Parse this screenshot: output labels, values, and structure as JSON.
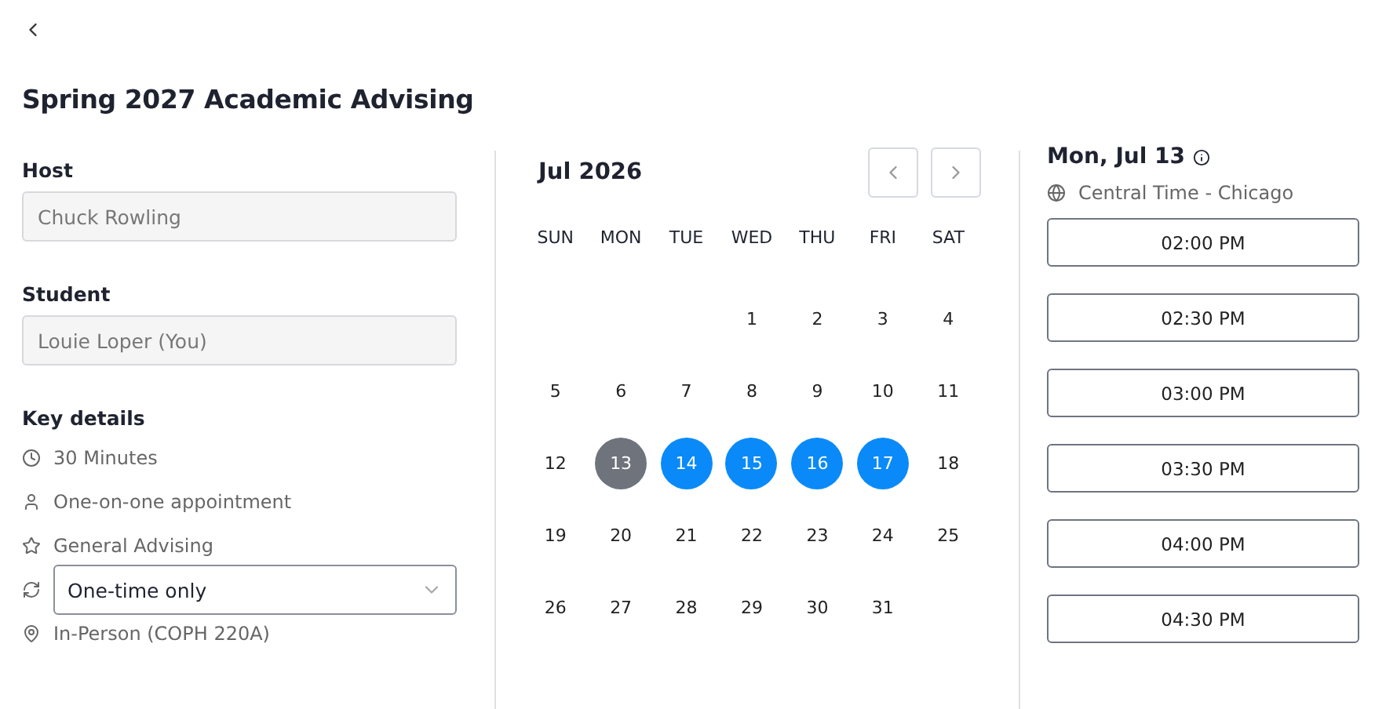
{
  "title": "Spring 2027 Academic Advising",
  "host": {
    "label": "Host",
    "value": "Chuck Rowling"
  },
  "student": {
    "label": "Student",
    "value": "Louie Loper (You)"
  },
  "key_details": {
    "label": "Key details",
    "items": [
      {
        "kind": "clock",
        "text": "30 Minutes"
      },
      {
        "kind": "person",
        "text": "One-on-one appointment"
      },
      {
        "kind": "star",
        "text": "General Advising"
      },
      {
        "kind": "repeat",
        "select": "One-time only"
      },
      {
        "kind": "location",
        "text": "In-Person (COPH 220A)"
      }
    ]
  },
  "calendar": {
    "month": "Jul 2026",
    "weekdays": [
      "SUN",
      "MON",
      "TUE",
      "WED",
      "THU",
      "FRI",
      "SAT"
    ],
    "weeks": [
      [
        {
          "day": "1",
          "available": false,
          "selected": false
        },
        {
          "day": "2",
          "available": false,
          "selected": false
        },
        {
          "day": "3",
          "available": false,
          "selected": false
        },
        {
          "day": "4",
          "available": false,
          "selected": false
        }
      ],
      [
        {
          "day": "5",
          "available": false,
          "selected": false
        },
        {
          "day": "6",
          "available": false,
          "selected": false
        },
        {
          "day": "7",
          "available": false,
          "selected": false
        },
        {
          "day": "8",
          "available": false,
          "selected": false
        },
        {
          "day": "9",
          "available": false,
          "selected": false
        },
        {
          "day": "10",
          "available": false,
          "selected": false
        },
        {
          "day": "11",
          "available": false,
          "selected": false
        }
      ],
      [
        {
          "day": "12",
          "available": false,
          "selected": false
        },
        {
          "day": "13",
          "available": true,
          "selected": true
        },
        {
          "day": "14",
          "available": true,
          "selected": false
        },
        {
          "day": "15",
          "available": true,
          "selected": false
        },
        {
          "day": "16",
          "available": true,
          "selected": false
        },
        {
          "day": "17",
          "available": true,
          "selected": false
        },
        {
          "day": "18",
          "available": false,
          "selected": false
        }
      ],
      [
        {
          "day": "19",
          "available": false,
          "selected": false
        },
        {
          "day": "20",
          "available": false,
          "selected": false
        },
        {
          "day": "21",
          "available": false,
          "selected": false
        },
        {
          "day": "22",
          "available": false,
          "selected": false
        },
        {
          "day": "23",
          "available": false,
          "selected": false
        },
        {
          "day": "24",
          "available": false,
          "selected": false
        },
        {
          "day": "25",
          "available": false,
          "selected": false
        }
      ],
      [
        {
          "day": "26",
          "available": false,
          "selected": false
        },
        {
          "day": "27",
          "available": false,
          "selected": false
        },
        {
          "day": "28",
          "available": false,
          "selected": false
        },
        {
          "day": "29",
          "available": false,
          "selected": false
        },
        {
          "day": "30",
          "available": false,
          "selected": false
        },
        {
          "day": "31",
          "available": false,
          "selected": false
        }
      ]
    ]
  },
  "slots": {
    "date": "Mon, Jul 13",
    "timezone": "Central Time - Chicago",
    "times": [
      "02:00 PM",
      "02:30 PM",
      "03:00 PM",
      "03:30 PM",
      "04:00 PM",
      "04:30 PM"
    ]
  }
}
